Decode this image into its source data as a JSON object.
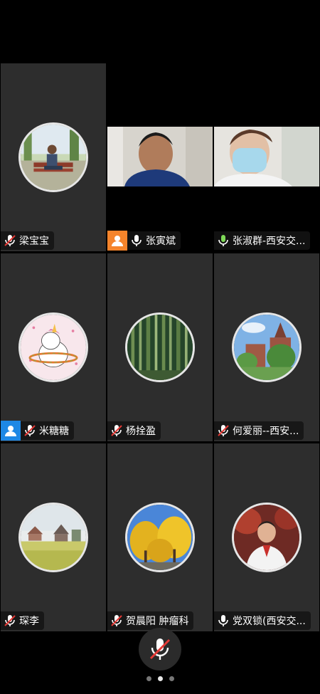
{
  "participants": [
    {
      "name": "梁宝宝",
      "mic": "muted",
      "host_badge": false,
      "badge_color": "",
      "view": "avatar",
      "avatar_subject": "man-on-bench-photo"
    },
    {
      "name": "张寅斌",
      "mic": "on",
      "host_badge": true,
      "badge_color": "#f5842b",
      "view": "video",
      "avatar_subject": "camera-feed-man"
    },
    {
      "name": "张淑群-西安交...",
      "mic": "on",
      "host_badge": false,
      "badge_color": "",
      "view": "video",
      "avatar_subject": "camera-feed-woman-mask"
    },
    {
      "name": "米糖糖",
      "mic": "muted",
      "host_badge": true,
      "badge_color": "#1e88e5",
      "view": "avatar",
      "avatar_subject": "unicorn-cartoon"
    },
    {
      "name": "杨拴盈",
      "mic": "muted",
      "host_badge": false,
      "badge_color": "",
      "view": "avatar",
      "avatar_subject": "bamboo-forest"
    },
    {
      "name": "何爱丽--西安...",
      "mic": "muted",
      "host_badge": false,
      "badge_color": "",
      "view": "avatar",
      "avatar_subject": "campus-building"
    },
    {
      "name": "琛李",
      "mic": "muted",
      "host_badge": false,
      "badge_color": "",
      "view": "avatar",
      "avatar_subject": "meadow-houses"
    },
    {
      "name": "贺晨阳 肿瘤科",
      "mic": "muted",
      "host_badge": false,
      "badge_color": "",
      "view": "avatar",
      "avatar_subject": "ginkgo-trees"
    },
    {
      "name": "党双锁(西安交...",
      "mic": "on",
      "host_badge": false,
      "badge_color": "",
      "view": "avatar",
      "avatar_subject": "doctor-portrait"
    }
  ],
  "controls": {
    "self_mic": "muted",
    "page_count": 3,
    "active_page": 2
  },
  "colors": {
    "tile_bg": "#2d2d2d",
    "mic_muted": "#e53935",
    "mic_on": "#ffffff"
  }
}
